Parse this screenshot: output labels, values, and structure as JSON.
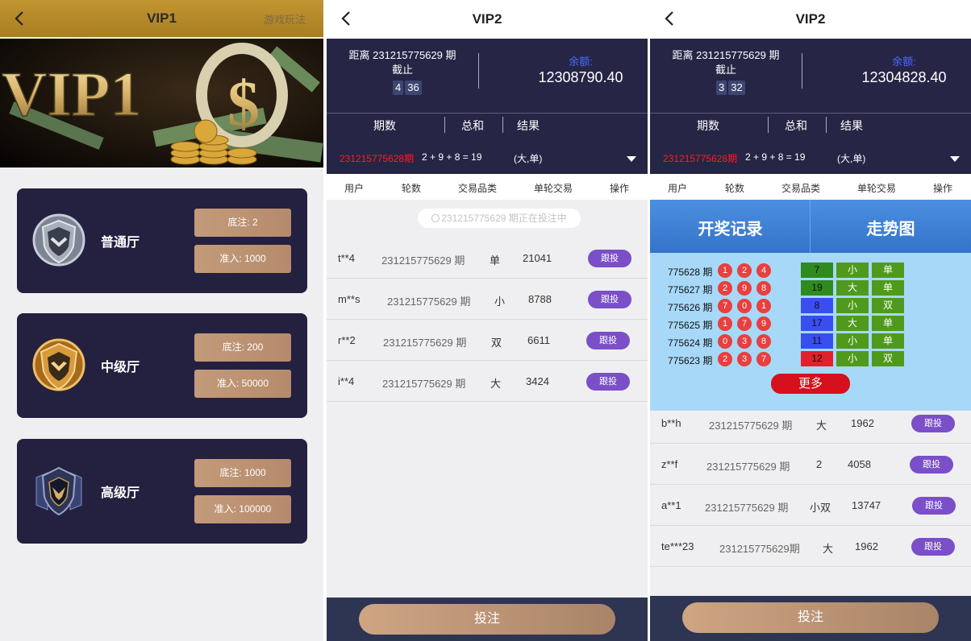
{
  "panel1": {
    "title": "VIP1",
    "rules": "游戏玩法",
    "banner_text": "VIP1",
    "halls": [
      {
        "name": "普通厅",
        "min_bet": "底注:  2",
        "entry": "准入: 1000"
      },
      {
        "name": "中级厅",
        "min_bet": "底注:  200",
        "entry": "准入: 50000"
      },
      {
        "name": "高级厅",
        "min_bet": "底注:  1000",
        "entry": "准入: 100000"
      }
    ]
  },
  "panel2": {
    "title": "VIP2",
    "period_line1": "距离 231215775629 期",
    "period_line2": "截止",
    "countdown": [
      "4",
      "36"
    ],
    "balance_label": "余额:",
    "balance": "12308790.40",
    "col_headers": [
      "期数",
      "总和",
      "结果"
    ],
    "last_period": "231215775628期",
    "last_sum": "2 + 9 + 8 = 19",
    "last_result": "(大,单)",
    "table_headers": [
      "用户",
      "轮数",
      "交易品类",
      "单轮交易",
      "操作"
    ],
    "notice": "231215775629 期正在投注中",
    "rows": [
      {
        "user": "t**4",
        "round": "231215775629 期",
        "type": "单",
        "amount": "21041",
        "action": "跟投"
      },
      {
        "user": "m**s",
        "round": "231215775629 期",
        "type": "小",
        "amount": "8788",
        "action": "跟投"
      },
      {
        "user": "r**2",
        "round": "231215775629 期",
        "type": "双",
        "amount": "6611",
        "action": "跟投"
      },
      {
        "user": "i**4",
        "round": "231215775629 期",
        "type": "大",
        "amount": "3424",
        "action": "跟投"
      }
    ],
    "bet_button": "投注"
  },
  "panel3": {
    "title": "VIP2",
    "period_line1": "距离 231215775629 期",
    "period_line2": "截止",
    "countdown": [
      "3",
      "32"
    ],
    "balance_label": "余额:",
    "balance": "12304828.40",
    "col_headers": [
      "期数",
      "总和",
      "结果"
    ],
    "last_period": "231215775628期",
    "last_sum": "2 + 9 + 8 = 19",
    "last_result": "(大,单)",
    "table_headers": [
      "用户",
      "轮数",
      "交易品类",
      "单轮交易",
      "操作"
    ],
    "tab_history": "开奖记录",
    "tab_trend": "走势图",
    "history": [
      {
        "period": "775628 期",
        "balls": [
          "1",
          "2",
          "4"
        ],
        "sum": "7",
        "size": "小",
        "parity": "单",
        "sum_color": "#2f8a20"
      },
      {
        "period": "775627 期",
        "balls": [
          "2",
          "9",
          "8"
        ],
        "sum": "19",
        "size": "大",
        "parity": "单",
        "sum_color": "#2f8a20"
      },
      {
        "period": "775626 期",
        "balls": [
          "7",
          "0",
          "1"
        ],
        "sum": "8",
        "size": "小",
        "parity": "双",
        "sum_color": "#3a4ef0"
      },
      {
        "period": "775625 期",
        "balls": [
          "1",
          "7",
          "9"
        ],
        "sum": "17",
        "size": "大",
        "parity": "单",
        "sum_color": "#3a4ef0"
      },
      {
        "period": "775624 期",
        "balls": [
          "0",
          "3",
          "8"
        ],
        "sum": "11",
        "size": "小",
        "parity": "单",
        "sum_color": "#3a4ef0"
      },
      {
        "period": "775623 期",
        "balls": [
          "2",
          "3",
          "7"
        ],
        "sum": "12",
        "size": "小",
        "parity": "双",
        "sum_color": "#e0202a"
      }
    ],
    "more": "更多",
    "rows": [
      {
        "user": "b**h",
        "round": "231215775629 期",
        "type": "大",
        "amount": "1962",
        "action": "跟投"
      },
      {
        "user": "z**f",
        "round": "231215775629 期",
        "type": "2",
        "amount": "4058",
        "action": "跟投"
      },
      {
        "user": "a**1",
        "round": "231215775629 期",
        "type": "小双",
        "amount": "13747",
        "action": "跟投"
      },
      {
        "user": "te***23",
        "round": "231215775629期",
        "type": "大",
        "amount": "1962",
        "action": "跟投"
      }
    ],
    "bet_button": "投注"
  }
}
